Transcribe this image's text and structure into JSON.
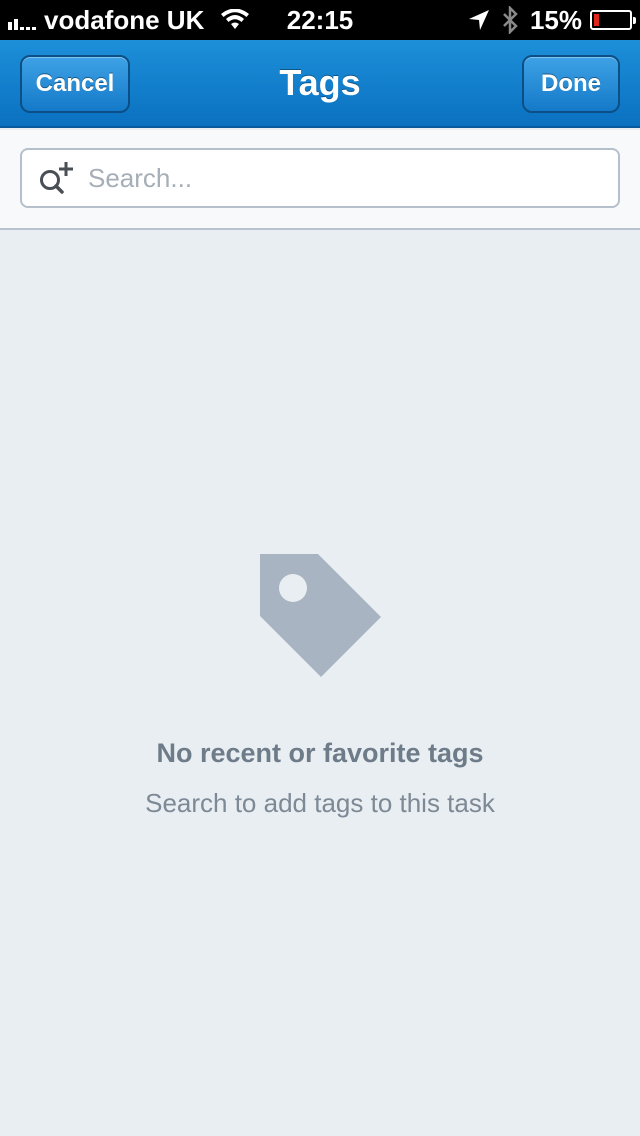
{
  "status_bar": {
    "carrier": "vodafone UK",
    "time": "22:15",
    "battery": "15%",
    "battery_level": 0.15,
    "battery_color": "#e0261c",
    "icons": [
      "signal-icon",
      "wifi-icon",
      "location-arrow-icon",
      "bluetooth-icon",
      "battery-icon"
    ]
  },
  "nav": {
    "title": "Tags",
    "cancel_label": "Cancel",
    "done_label": "Done",
    "accent": "#0a71c0"
  },
  "search": {
    "placeholder": "Search...",
    "value": "",
    "icon": "search-add-icon"
  },
  "empty_state": {
    "icon": "tag-icon",
    "title": "No recent or favorite tags",
    "subtitle": "Search to add tags to this task"
  }
}
